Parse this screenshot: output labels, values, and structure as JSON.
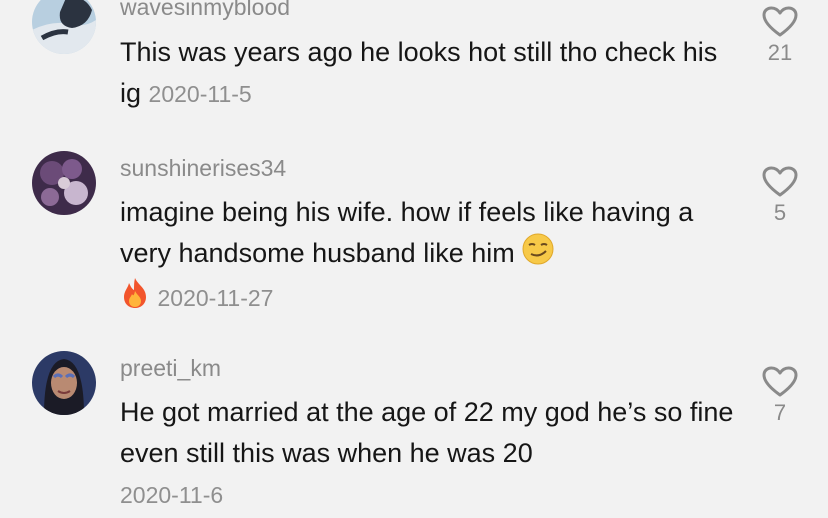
{
  "comments": [
    {
      "username": "wavesinmyblood",
      "text": "This was years ago he looks hot still tho check his ig",
      "date": "2020-11-5",
      "likes": "21",
      "avatar_colors": [
        "#b8cfe0",
        "#2b3340",
        "#e2e8ee"
      ]
    },
    {
      "username": "sunshinerises34",
      "text": "imagine being his wife. how if feels like having a very handsome husband like him",
      "emoji_inline": "smirk-emoji",
      "emoji_next_line": "fire-emoji",
      "date": "2020-11-27",
      "likes": "5",
      "avatar_colors": [
        "#6b4b78",
        "#3e2b4a",
        "#c8b6cf"
      ]
    },
    {
      "username": "preeti_km",
      "text": "He got married at the age of 22 my god he’s so fine even still this was when he was 20",
      "date": "2020-11-6",
      "likes": "7",
      "avatar_colors": [
        "#2c3a66",
        "#b98a72",
        "#5a6fb8"
      ]
    }
  ]
}
